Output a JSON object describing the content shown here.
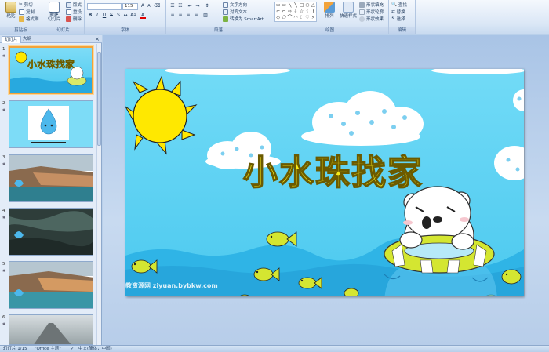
{
  "ribbon": {
    "clipboard": {
      "paste": "粘贴",
      "cut": "剪切",
      "copy": "复制",
      "format_painter": "格式刷",
      "label": "剪贴板"
    },
    "slides": {
      "new_slide": "新建\n幻灯片",
      "layout": "版式",
      "reset": "重设",
      "delete": "删除",
      "label": "幻灯片"
    },
    "font": {
      "size": "115",
      "label": "字体"
    },
    "paragraph": {
      "text_direction": "文字方向",
      "align_text": "对齐文本",
      "smartart": "转换为 SmartArt",
      "label": "段落"
    },
    "drawing": {
      "arrange": "排列",
      "quick_styles": "快速样式",
      "shape_fill": "形状填充",
      "shape_outline": "形状轮廓",
      "shape_effects": "形状效果",
      "label": "绘图"
    },
    "editing": {
      "find": "查找",
      "replace": "替换",
      "select": "选择",
      "label": "编辑"
    }
  },
  "panel": {
    "tab_slides": "幻灯片",
    "tab_outline": "大纲",
    "close": "×",
    "thumbnails": [
      {
        "num": "1",
        "kind": "title",
        "mini_title": "小水珠找家"
      },
      {
        "num": "2",
        "kind": "drop"
      },
      {
        "num": "3",
        "kind": "coast"
      },
      {
        "num": "4",
        "kind": "water"
      },
      {
        "num": "5",
        "kind": "coast"
      },
      {
        "num": "6",
        "kind": "road"
      }
    ]
  },
  "slide": {
    "title": "小水珠找家",
    "watermark": "教资源网 ziyuan.bybkw.com"
  },
  "status": {
    "slide_counter": "幻灯片 1/15",
    "theme": "\"Office 主题\"",
    "language": "中文(简体，中国)"
  },
  "colors": {
    "accent": "#f2a33b",
    "sky": "#72dbf7",
    "sea": "#2fb4e6",
    "title": "#f7ea18"
  }
}
